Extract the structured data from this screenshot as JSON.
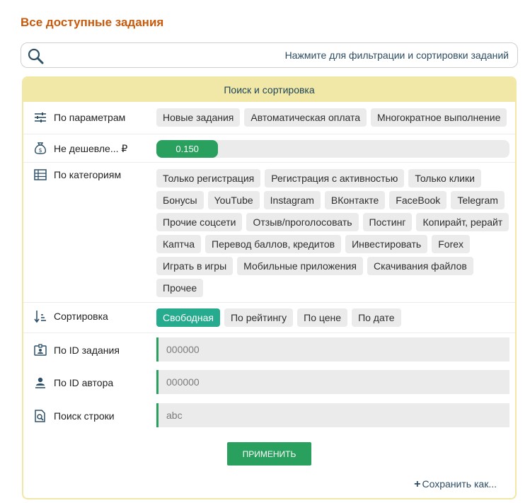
{
  "page_title": "Все доступные задания",
  "filter_bar": {
    "text": "Нажмите для фильтрации и сортировки заданий",
    "icon": "search-icon"
  },
  "panel": {
    "title": "Поиск и сортировка",
    "params": {
      "label": "По параметрам",
      "icon": "sliders-icon",
      "chips": [
        "Новые задания",
        "Автоматическая оплата",
        "Многократное выполнение"
      ]
    },
    "price": {
      "label": "Не дешевле... ₽",
      "icon": "money-bag-icon",
      "value": "0.150",
      "slider_fraction": 0.175
    },
    "categories": {
      "label": "По категориям",
      "icon": "table-icon",
      "chips": [
        "Только регистрация",
        "Регистрация с активностью",
        "Только клики",
        "Бонусы",
        "YouTube",
        "Instagram",
        "ВКонтакте",
        "FaceBook",
        "Telegram",
        "Прочие соцсети",
        "Отзыв/проголосовать",
        "Постинг",
        "Копирайт, рерайт",
        "Каптча",
        "Перевод баллов, кредитов",
        "Инвестировать",
        "Forex",
        "Играть в игры",
        "Мобильные приложения",
        "Скачивания файлов",
        "Прочее"
      ]
    },
    "sorting": {
      "label": "Сортировка",
      "icon": "sort-icon",
      "options": [
        "Свободная",
        "По рейтингу",
        "По цене",
        "По дате"
      ],
      "active": "Свободная"
    },
    "task_id": {
      "label": "По ID задания",
      "icon": "id-card-icon",
      "placeholder": "000000"
    },
    "author_id": {
      "label": "По ID автора",
      "icon": "author-icon",
      "placeholder": "000000"
    },
    "search_string": {
      "label": "Поиск строки",
      "icon": "file-search-icon",
      "placeholder": "abc"
    },
    "apply_label": "ПРИМЕНИТЬ",
    "save_label": "Сохранить как..."
  },
  "colors": {
    "title": "#c85a0c",
    "header_bg": "#f1e8a7",
    "accent_green": "#2aa05e",
    "active_chip": "#27ab8e",
    "chip_bg": "#ebebeb"
  }
}
